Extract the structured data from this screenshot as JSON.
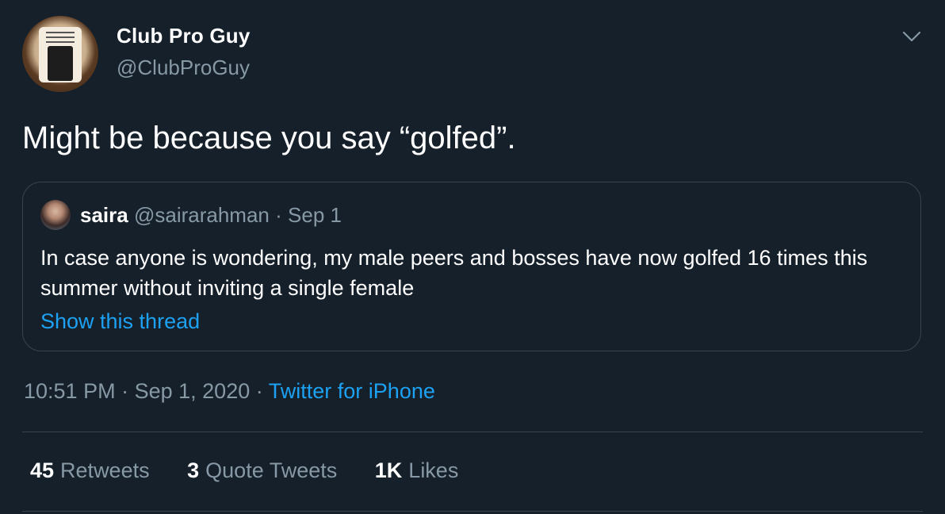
{
  "tweet": {
    "author": {
      "name": "Club Pro Guy",
      "handle": "@ClubProGuy"
    },
    "text": "Might be because you say “golfed”.",
    "quoted": {
      "name": "saira",
      "handle": "@sairarahman",
      "separator": "·",
      "date": "Sep 1",
      "text": "In case anyone is wondering, my male peers and bosses have now golfed 16 times this summer without inviting a single female",
      "show_thread": "Show this thread"
    },
    "meta": {
      "time": "10:51 PM",
      "date": "Sep 1, 2020",
      "separator": "·",
      "source": "Twitter for iPhone"
    },
    "stats": {
      "retweets_count": "45",
      "retweets_label": "Retweets",
      "quotes_count": "3",
      "quotes_label": "Quote Tweets",
      "likes_count": "1K",
      "likes_label": "Likes"
    }
  },
  "icons": {
    "more": "chevron-down-icon"
  },
  "colors": {
    "background": "#15202b",
    "text_primary": "#ffffff",
    "text_secondary": "#8899a6",
    "link": "#1da1f2",
    "border": "#38444d"
  }
}
